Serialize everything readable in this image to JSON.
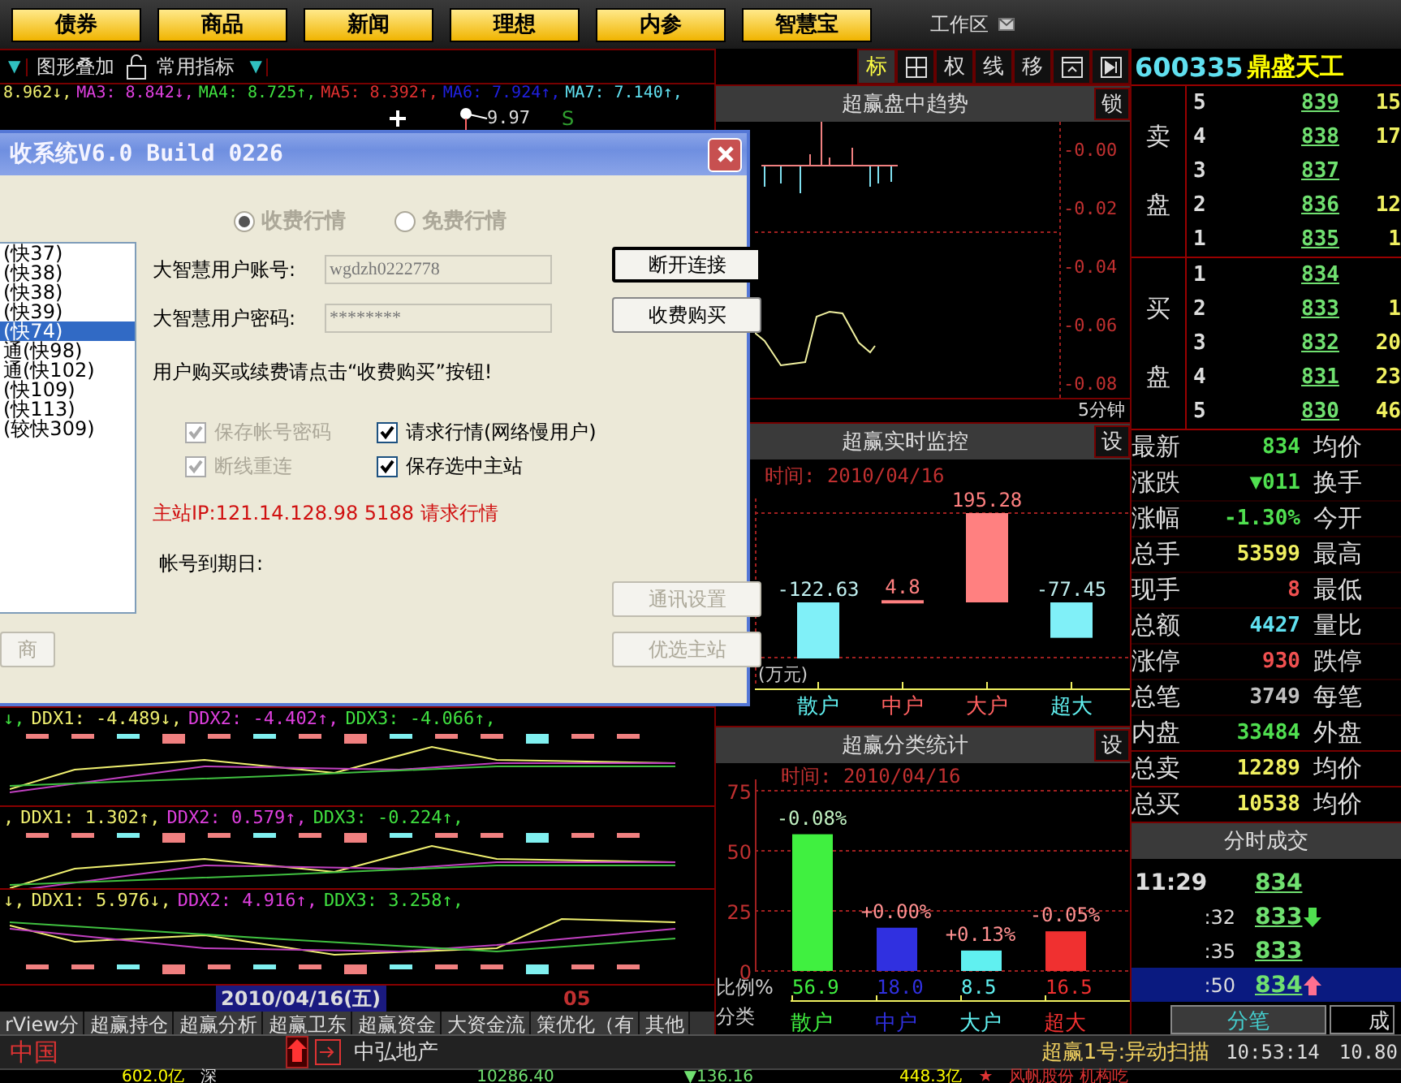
{
  "menu_buttons": [
    "债券",
    "商品",
    "新闻",
    "理想",
    "内参",
    "智慧宝"
  ],
  "workspace": {
    "label": "工作区"
  },
  "chart_toolbar": {
    "dropdown": "▼",
    "overlay": "图形叠加",
    "indicators": "常用指标",
    "indicators_dropdown": "▼"
  },
  "tool_buttons": [
    {
      "kind": "text",
      "label": "标",
      "selected": true
    },
    {
      "kind": "grid",
      "selected": false
    },
    {
      "kind": "text",
      "label": "权",
      "selected": false
    },
    {
      "kind": "text",
      "label": "线",
      "selected": false
    },
    {
      "kind": "text",
      "label": "移",
      "selected": false
    },
    {
      "kind": "panel",
      "selected": false
    },
    {
      "kind": "play",
      "selected": false
    }
  ],
  "ma_line": [
    {
      "text": "8.962↓,",
      "color": "#f0f070"
    },
    {
      "text": "MA3: 8.842↓,",
      "color": "#e040e0"
    },
    {
      "text": "MA4: 8.725↑,",
      "color": "#40e040"
    },
    {
      "text": "MA5: 8.392↑,",
      "color": "#e03030"
    },
    {
      "text": "MA6: 7.924↑,",
      "color": "#2020e0"
    },
    {
      "text": "MA7: 7.140↑,",
      "color": "#60e0f0"
    }
  ],
  "price_marker": "9.97",
  "signal": "S",
  "ddx_panels": [
    {
      "items": [
        {
          "text": "↓,",
          "color": "#40e040"
        },
        {
          "text": "DDX1: -4.489↓,",
          "color": "#f0f070"
        },
        {
          "text": "DDX2: -4.402↑,",
          "color": "#e040e0"
        },
        {
          "text": "DDX3: -4.066↑,",
          "color": "#40e040"
        }
      ]
    },
    {
      "items": [
        {
          "text": ",",
          "color": "#f0f070"
        },
        {
          "text": "DDX1: 1.302↑,",
          "color": "#f0f070"
        },
        {
          "text": "DDX2: 0.579↑,",
          "color": "#e040e0"
        },
        {
          "text": "DDX3: -0.224↑,",
          "color": "#40e040"
        }
      ]
    },
    {
      "items": [
        {
          "text": "↓,",
          "color": "#f0f070"
        },
        {
          "text": "DDX1: 5.976↓,",
          "color": "#f0f070"
        },
        {
          "text": "DDX2: 4.916↑,",
          "color": "#e040e0"
        },
        {
          "text": "DDX3: 3.258↑,",
          "color": "#40e040"
        }
      ]
    }
  ],
  "date_axis": {
    "date": "2010/04/16(五)",
    "next": "05"
  },
  "bottom_tabs": [
    {
      "label": "rView分",
      "selected": false
    },
    {
      "label": "超赢持仓",
      "selected": false
    },
    {
      "label": "超赢分析",
      "selected": false
    },
    {
      "label": "超赢卫东",
      "selected": false
    },
    {
      "label": "超赢资金",
      "selected": false
    },
    {
      "label": "大资金流",
      "selected": false
    },
    {
      "label": "策优化（有",
      "selected": false
    },
    {
      "label": "其他",
      "selected": false
    }
  ],
  "dialog": {
    "title": "收系统V6.0 Build 0226",
    "radios": [
      {
        "label": "收费行情",
        "selected": true,
        "disabled": true
      },
      {
        "label": "免费行情",
        "selected": false,
        "disabled": true
      }
    ],
    "servers": [
      {
        "label": "(快37)",
        "selected": false
      },
      {
        "label": "(快38)",
        "selected": false
      },
      {
        "label": "(快38)",
        "selected": false
      },
      {
        "label": "(快39)",
        "selected": false
      },
      {
        "label": "(快74)",
        "selected": true
      },
      {
        "label": "通(快98)",
        "selected": false
      },
      {
        "label": "通(快102)",
        "selected": false
      },
      {
        "label": "(快109)",
        "selected": false
      },
      {
        "label": "(快113)",
        "selected": false
      },
      {
        "label": "(较快309)",
        "selected": false
      }
    ],
    "left_button": {
      "label": "商",
      "disabled": true
    },
    "fields": [
      {
        "label": "大智慧用户账号:",
        "value": "wgdzh0222778"
      },
      {
        "label": "大智慧用户密码:",
        "value": "********"
      }
    ],
    "buttons": [
      {
        "label": "断开连接",
        "default": true,
        "disabled": false
      },
      {
        "label": "收费购买",
        "default": false,
        "disabled": false
      }
    ],
    "hint": "用户购买或续费请点击“收费购买”按钮!",
    "checkboxes": [
      {
        "label": "保存帐号密码",
        "checked": true,
        "disabled": true
      },
      {
        "label": "请求行情(网络慢用户)",
        "checked": true,
        "disabled": false
      },
      {
        "label": "断线重连",
        "checked": true,
        "disabled": true
      },
      {
        "label": "保存选中主站",
        "checked": true,
        "disabled": false
      }
    ],
    "server_ip": "主站IP:121.14.128.98 5188 请求行情",
    "expiry_label": "帐号到期日:",
    "bottom_buttons": [
      {
        "label": "通讯设置",
        "disabled": true
      },
      {
        "label": "优选主站",
        "disabled": true
      }
    ]
  },
  "trend_panel": {
    "title": "超赢盘中趋势",
    "lock": "锁",
    "axis_labels": [
      "-0.00",
      "-0.02",
      "-0.04",
      "-0.06",
      "-0.08"
    ],
    "period": "5分钟"
  },
  "monitor_panel": {
    "title": "超赢实时监控",
    "settings": "设",
    "time": "时间: 2010/04/16",
    "unit": "(万元)",
    "chart_data": {
      "type": "bar",
      "categories": [
        "散户",
        "中户",
        "大户",
        "超大"
      ],
      "values": [
        -122.63,
        4.8,
        195.28,
        -77.45
      ],
      "data_labels": true
    }
  },
  "stats_panel": {
    "title": "超赢分类统计",
    "settings": "设",
    "time": "时间: 2010/04/16",
    "ratio_label": "比例%",
    "category_label": "分类",
    "ratio_row": [
      {
        "value": "56.9",
        "color": "#40f040",
        "change": "-0.08%"
      },
      {
        "value": "18.0",
        "color": "#3030e0",
        "change": "+0.00%"
      },
      {
        "value": "8.5",
        "color": "#60f0f0",
        "change": "+0.13%"
      },
      {
        "value": "16.5",
        "color": "#f03030",
        "change": "-0.05%"
      }
    ],
    "chart_data": {
      "type": "bar",
      "categories": [
        "散户",
        "中户",
        "大户",
        "超大"
      ],
      "values": [
        56.9,
        18.0,
        8.5,
        16.5
      ],
      "ylim": [
        0,
        75
      ],
      "yticks": [
        0,
        25,
        50,
        75
      ]
    }
  },
  "quote_header": {
    "code": "600335",
    "name": "鼎盛天工"
  },
  "order_book": {
    "sell_label": [
      "卖",
      "盘"
    ],
    "buy_label": [
      "买",
      "盘"
    ],
    "sell": [
      {
        "level": "5",
        "price": "839",
        "volume": "15"
      },
      {
        "level": "4",
        "price": "838",
        "volume": "17"
      },
      {
        "level": "3",
        "price": "837"
      },
      {
        "level": "2",
        "price": "836",
        "volume": "12"
      },
      {
        "level": "1",
        "price": "835",
        "volume": "1"
      }
    ],
    "buy": [
      {
        "level": "1",
        "price": "834"
      },
      {
        "level": "2",
        "price": "833",
        "volume": "1"
      },
      {
        "level": "3",
        "price": "832",
        "volume": "20"
      },
      {
        "level": "4",
        "price": "831",
        "volume": "23"
      },
      {
        "level": "5",
        "price": "830",
        "volume": "46"
      }
    ]
  },
  "stats": [
    {
      "label": "最新",
      "value": "834",
      "color": "#50e050",
      "label2": "均价"
    },
    {
      "label": "涨跌",
      "value": "▼011",
      "color": "#50e050",
      "label2": "换手"
    },
    {
      "label": "涨幅",
      "value": "-1.30%",
      "color": "#50e050",
      "label2": "今开"
    },
    {
      "label": "总手",
      "value": "53599",
      "color": "#f0f060",
      "label2": "最高"
    },
    {
      "label": "现手",
      "value": "8",
      "color": "#f05050",
      "label2": "最低"
    },
    {
      "label": "总额",
      "value": "4427",
      "color": "#60e0f0",
      "label2": "量比"
    },
    {
      "label": "涨停",
      "value": "930",
      "color": "#f05050",
      "label2": "跌停"
    },
    {
      "label": "总笔",
      "value": "3749",
      "color": "#c0c0c0",
      "label2": "每笔"
    },
    {
      "label": "内盘",
      "value": "33484",
      "color": "#50e050",
      "label2": "外盘"
    },
    {
      "label": "总卖",
      "value": "12289",
      "color": "#f0f060",
      "label2": "均价"
    },
    {
      "label": "总买",
      "value": "10538",
      "color": "#f0f060",
      "label2": "均价"
    }
  ],
  "trades_title": "分时成交",
  "trades": [
    {
      "time": "11:29",
      "price": "834",
      "down_arrow": false,
      "up_arrow": false,
      "selected": false
    },
    {
      "time": ":32",
      "price": "833",
      "down_arrow": true,
      "up_arrow": false,
      "selected": false
    },
    {
      "time": ":35",
      "price": "833",
      "down_arrow": false,
      "up_arrow": false,
      "selected": false
    },
    {
      "time": ":50",
      "price": "834",
      "down_arrow": false,
      "up_arrow": true,
      "selected": true
    }
  ],
  "trade_tabs": [
    {
      "label": "分笔",
      "selected": true
    },
    {
      "label": "成",
      "selected": false
    }
  ],
  "status": {
    "market": "中国",
    "stock": "中弘地产",
    "scan": "超赢1号:异动扫描",
    "time": "10:53:14",
    "price": "10.80"
  },
  "ticker": [
    "602.0亿",
    "深",
    "10286.40",
    "▼136.16",
    "448.3亿",
    "★",
    "风帆股份 机构吃"
  ]
}
